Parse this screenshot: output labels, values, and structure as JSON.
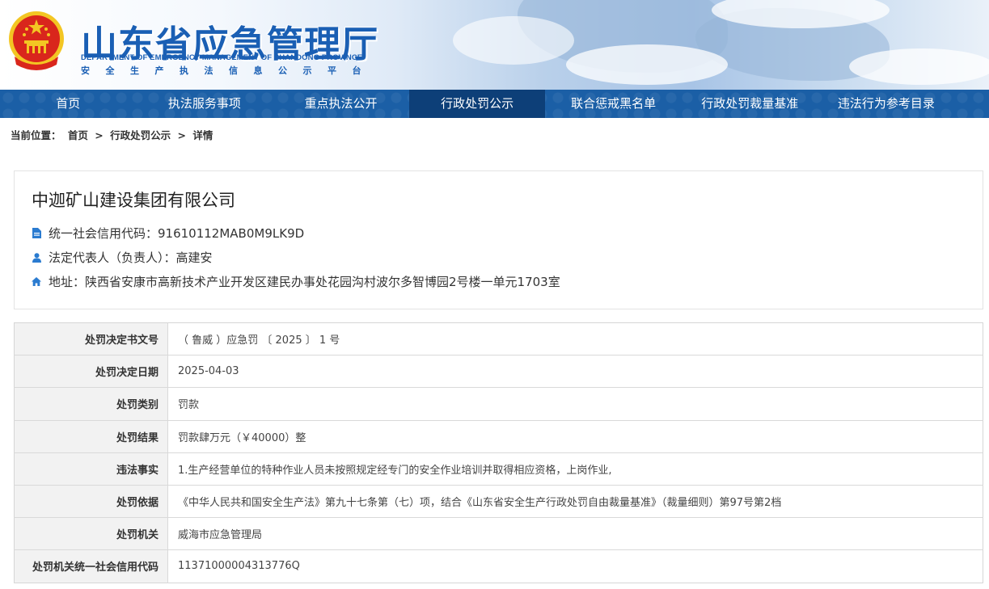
{
  "header": {
    "title": "山东省应急管理厅",
    "title_en": "DEPARTMENT OF EMERGENCY MANAGEMENT OF SHANDONG PROVINCE",
    "subtitle": "安全生产执法信息公示平台"
  },
  "nav": {
    "items": [
      {
        "label": "首页"
      },
      {
        "label": "执法服务事项"
      },
      {
        "label": "重点执法公开"
      },
      {
        "label": "行政处罚公示"
      },
      {
        "label": "联合惩戒黑名单"
      },
      {
        "label": "行政处罚裁量基准"
      },
      {
        "label": "违法行为参考目录"
      }
    ],
    "active_index": 3
  },
  "breadcrumb": {
    "prefix": "当前位置：",
    "items": [
      "首页",
      "行政处罚公示",
      "详情"
    ],
    "separator": ">"
  },
  "company": {
    "name": "中迦矿山建设集团有限公司",
    "credit_code": "统一社会信用代码：91610112MAB0M9LK9D",
    "legal_rep": "法定代表人（负责人）：高建安",
    "address": "地址：陕西省安康市高新技术产业开发区建民办事处花园沟村波尔多智博园2号楼一单元1703室"
  },
  "details": [
    {
      "label": "处罚决定书文号",
      "value": "（ 鲁威 ）应急罚 〔 2025 〕 1 号"
    },
    {
      "label": "处罚决定日期",
      "value": "2025-04-03"
    },
    {
      "label": "处罚类别",
      "value": "罚款"
    },
    {
      "label": "处罚结果",
      "value": "罚款肆万元（￥40000）整"
    },
    {
      "label": "违法事实",
      "value": "1.生产经营单位的特种作业人员未按照规定经专门的安全作业培训并取得相应资格，上岗作业,"
    },
    {
      "label": "处罚依据",
      "value": "《中华人民共和国安全生产法》第九十七条第（七）项，结合《山东省安全生产行政处罚自由裁量基准》（裁量细则）第97号第2档"
    },
    {
      "label": "处罚机关",
      "value": "威海市应急管理局"
    },
    {
      "label": "处罚机关统一社会信用代码",
      "value": "11371000004313776Q"
    }
  ],
  "colors": {
    "brand_blue": "#1a5fb4",
    "nav_bg": "#1b5fa6",
    "nav_active": "#0d3f78",
    "icon_blue": "#2a7bd0",
    "emblem_red": "#d9261c",
    "emblem_gold": "#f3c623"
  },
  "icons": {
    "credit_code": "document-icon",
    "legal_rep": "user-icon",
    "address": "home-icon"
  }
}
